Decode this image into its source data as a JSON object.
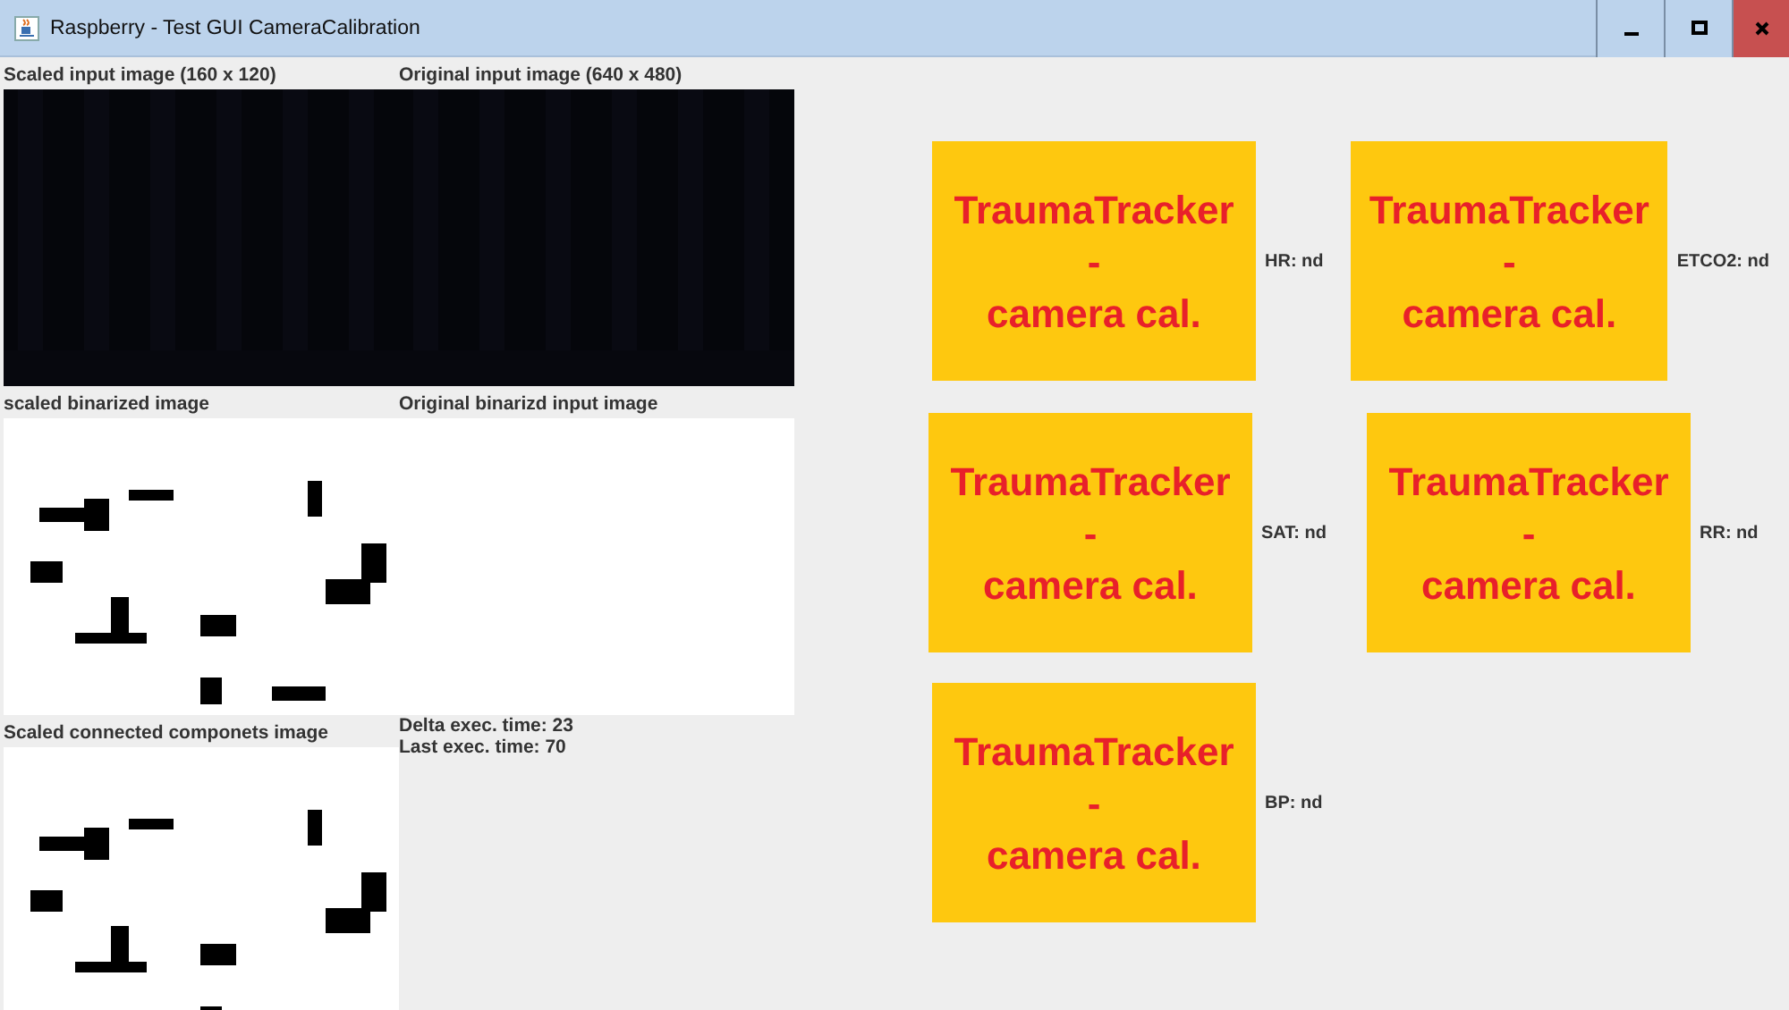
{
  "window": {
    "title": "Raspberry - Test GUI CameraCalibration"
  },
  "panels": [
    {
      "label": "Scaled input image (160 x 120)",
      "kind": "picture"
    },
    {
      "label": "Original input image (640 x 480)",
      "kind": "picture"
    },
    {
      "label": "scaled binarized image",
      "kind": "picture"
    },
    {
      "label": "Original binarizd input image",
      "kind": "blank"
    },
    {
      "label": "Scaled connected componets image",
      "kind": "picture"
    }
  ],
  "timings": [
    "Delta exec. time: 23",
    "Last exec. time: 70"
  ],
  "tile_rows": [
    [
      {
        "title": "TraumaTracker\n-\ncamera cal.",
        "reading": "HR: nd"
      },
      {
        "title": "TraumaTracker\n-\ncamera cal.",
        "reading": "ETCO2: nd"
      }
    ],
    [
      {
        "title": "TraumaTracker\n-\ncamera cal.",
        "reading": "SAT: nd"
      },
      {
        "title": "TraumaTracker\n-\ncamera cal.",
        "reading": "RR: nd"
      }
    ],
    [
      {
        "title": "TraumaTracker\n-\ncamera cal.",
        "reading": "BP: nd"
      }
    ]
  ]
}
